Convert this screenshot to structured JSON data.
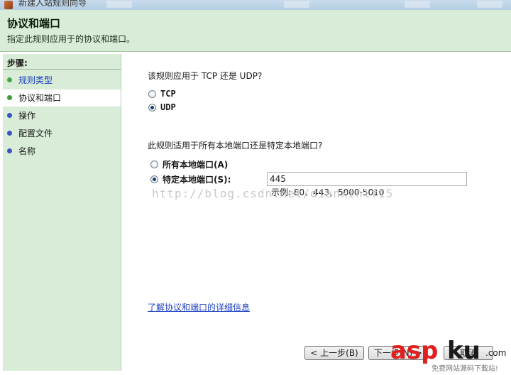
{
  "window": {
    "title": "新建入站规则向导"
  },
  "header": {
    "title": "协议和端口",
    "description": "指定此规则应用于的协议和端口。"
  },
  "sidebar": {
    "steps_label": "步骤:",
    "items": [
      {
        "label": "规则类型",
        "state": "done"
      },
      {
        "label": "协议和端口",
        "state": "current"
      },
      {
        "label": "操作",
        "state": "todo"
      },
      {
        "label": "配置文件",
        "state": "todo"
      },
      {
        "label": "名称",
        "state": "todo"
      }
    ]
  },
  "protocol": {
    "question": "该规则应用于 TCP 还是 UDP?",
    "options": [
      {
        "label": "TCP",
        "selected": false
      },
      {
        "label": "UDP",
        "selected": true
      }
    ]
  },
  "ports": {
    "question": "此规则适用于所有本地端口还是特定本地端口?",
    "options": [
      {
        "label": "所有本地端口(A)",
        "selected": false
      },
      {
        "label": "特定本地端口(S):",
        "selected": true
      }
    ],
    "value": "445",
    "example": "示例: 80、443、5000-5010"
  },
  "watermark": "http://blog.csdn.net/dianxinlf15",
  "learn_more_link": "了解协议和端口的详细信息",
  "buttons": {
    "back": "< 上一步(B)",
    "next": "下一步(N) >",
    "cancel": "取消"
  },
  "logo": {
    "asp": "asp",
    "ku": "ku",
    "com": ".com",
    "tagline": "免费网站源码下载站!"
  }
}
